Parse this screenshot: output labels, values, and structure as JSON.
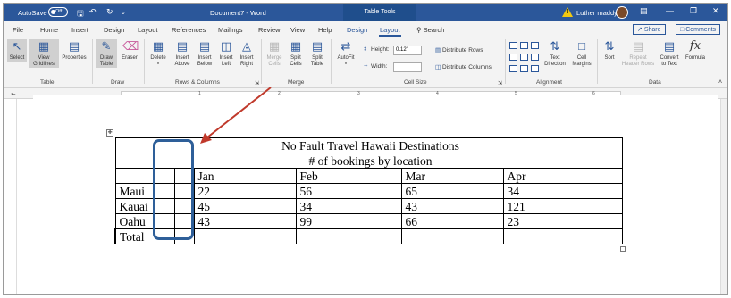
{
  "titlebar": {
    "autosave_label": "AutoSave",
    "autosave_state": "Off",
    "document_title": "Document7 - Word",
    "context_tab": "Table Tools",
    "user_name": "Luther maddy",
    "warning_glyph": "!"
  },
  "tabs": [
    "File",
    "Home",
    "Insert",
    "Design",
    "Layout",
    "References",
    "Mailings",
    "Review",
    "View",
    "Help",
    "Design",
    "Layout"
  ],
  "search_label": "Search",
  "share_label": "Share",
  "comments_label": "Comments",
  "ribbon": {
    "table_group": {
      "label": "Table",
      "select": "Select",
      "view_gridlines_1": "View",
      "view_gridlines_2": "Gridlines",
      "properties": "Properties"
    },
    "draw_group": {
      "label": "Draw",
      "draw_table_1": "Draw",
      "draw_table_2": "Table",
      "eraser": "Eraser"
    },
    "rows_cols_group": {
      "label": "Rows & Columns",
      "delete": "Delete",
      "insert_above_1": "Insert",
      "insert_above_2": "Above",
      "insert_below_1": "Insert",
      "insert_below_2": "Below",
      "insert_left_1": "Insert",
      "insert_left_2": "Left",
      "insert_right_1": "Insert",
      "insert_right_2": "Right"
    },
    "merge_group": {
      "label": "Merge",
      "merge_cells_1": "Merge",
      "merge_cells_2": "Cells",
      "split_cells_1": "Split",
      "split_cells_2": "Cells",
      "split_table_1": "Split",
      "split_table_2": "Table"
    },
    "cell_size_group": {
      "label": "Cell Size",
      "autofit": "AutoFit",
      "height_label": "Height:",
      "height_value": "0.12\"",
      "width_label": "Width:",
      "distribute_rows": "Distribute Rows",
      "distribute_columns": "Distribute Columns"
    },
    "alignment_group": {
      "label": "Alignment",
      "text_direction_1": "Text",
      "text_direction_2": "Direction",
      "cell_margins_1": "Cell",
      "cell_margins_2": "Margins"
    },
    "data_group": {
      "label": "Data",
      "sort": "Sort",
      "repeat_header_1": "Repeat",
      "repeat_header_2": "Header Rows",
      "convert_1": "Convert",
      "convert_2": "to Text",
      "formula": "Formula"
    }
  },
  "ruler_numbers": [
    "1",
    "2",
    "3",
    "4",
    "5",
    "6"
  ],
  "table": {
    "title": "No Fault Travel Hawaii Destinations",
    "subtitle": "# of bookings by location",
    "months": [
      "Jan",
      "Feb",
      "Mar",
      "Apr"
    ],
    "rows": [
      {
        "label": "Maui",
        "values": [
          "22",
          "56",
          "65",
          "34"
        ]
      },
      {
        "label": "Kauai",
        "values": [
          "45",
          "34",
          "43",
          "121"
        ]
      },
      {
        "label": "Oahu",
        "values": [
          "43",
          "99",
          "66",
          "23"
        ]
      },
      {
        "label": "Total",
        "values": [
          "",
          "",
          "",
          ""
        ]
      }
    ]
  },
  "colors": {
    "accent": "#2b579a",
    "annotation_arrow": "#c0392b",
    "highlight_box": "#2e5f99"
  }
}
